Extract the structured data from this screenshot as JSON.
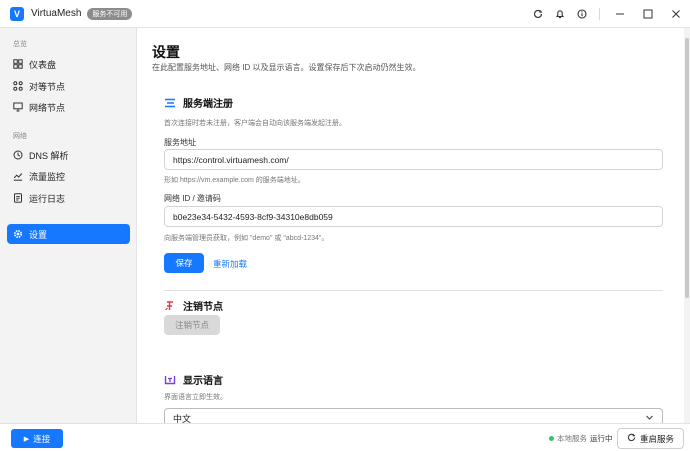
{
  "app": {
    "logo_letter": "V",
    "name": "VirtuaMesh",
    "status_badge": "服务不可用"
  },
  "sidebar": {
    "group_overview": "总览",
    "group_network": "网络",
    "items": [
      {
        "label": "仪表盘",
        "icon": "dashboard-icon"
      },
      {
        "label": "对等节点",
        "icon": "peers-icon"
      },
      {
        "label": "网络节点",
        "icon": "monitor-icon"
      },
      {
        "label": "DNS 解析",
        "icon": "dns-icon"
      },
      {
        "label": "流量监控",
        "icon": "traffic-chart-icon"
      },
      {
        "label": "运行日志",
        "icon": "log-icon"
      },
      {
        "label": "设置",
        "icon": "gear-icon"
      }
    ]
  },
  "main": {
    "title": "设置",
    "subtitle": "在此配置服务地址、网络 ID 以及显示语言。设置保存后下次启动仍然生效。",
    "register": {
      "heading": "服务端注册",
      "hint": "首次连接时若未注册，客户端会自动向该服务端发起注册。",
      "server_label": "服务地址",
      "server_value": "https://control.virtuamesh.com/",
      "server_help": "形如 https://vm.example.com 的服务端地址。",
      "network_label": "网络 ID / 邀请码",
      "network_value": "b0e23e34-5432-4593-8cf9-34310e8db059",
      "network_help": "向服务端管理员获取，例如 \"demo\" 或 \"abcd-1234\"。",
      "save_label": "保存",
      "reload_label": "重新加载"
    },
    "unregister": {
      "heading": "注销节点",
      "button_label": "注销节点"
    },
    "language": {
      "heading": "显示语言",
      "hint": "界面语言立即生效。",
      "selected": "中文"
    }
  },
  "bottom": {
    "connect_label": "连接",
    "service_label": "本地服务",
    "service_state": "运行中",
    "restart_label": "重启服务"
  },
  "colors": {
    "accent": "#1677ff",
    "danger": "#e0393e",
    "purple": "#7a3fe0",
    "ok": "#33c26b"
  }
}
